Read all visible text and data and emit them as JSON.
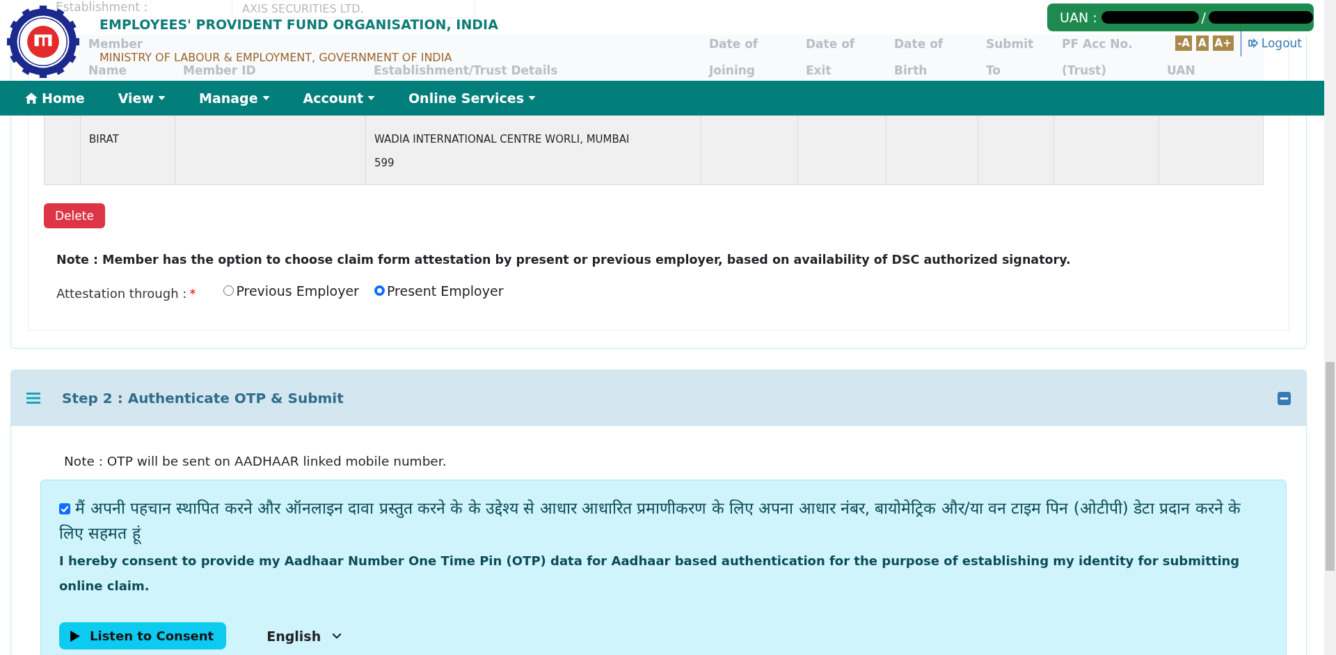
{
  "establishment": {
    "label": "Establishment :",
    "value": "AXIS SECURITIES LTD."
  },
  "header": {
    "title": "EMPLOYEES' PROVIDENT FUND ORGANISATION, INDIA",
    "subtitle": "MINISTRY OF LABOUR & EMPLOYMENT, GOVERNMENT OF INDIA",
    "uan_label": "UAN :",
    "uan_separator": "/",
    "font_sizes": [
      "-A",
      "A",
      "A+"
    ],
    "logout": "Logout"
  },
  "nav": [
    {
      "label": "Home",
      "kind": "home"
    },
    {
      "label": "View",
      "kind": "dropdown"
    },
    {
      "label": "Manage",
      "kind": "dropdown"
    },
    {
      "label": "Account",
      "kind": "dropdown"
    },
    {
      "label": "Online Services",
      "kind": "dropdown"
    }
  ],
  "table": {
    "columns": [
      {
        "lines": [
          "Member",
          "Name"
        ]
      },
      {
        "lines": [
          "Member ID"
        ]
      },
      {
        "lines": [
          "Establishment/Trust Details"
        ]
      },
      {
        "lines": [
          "Date of",
          "Joining"
        ]
      },
      {
        "lines": [
          "Date of",
          "Exit"
        ]
      },
      {
        "lines": [
          "Date of",
          "Birth"
        ]
      },
      {
        "lines": [
          "Submit",
          "To"
        ]
      },
      {
        "lines": [
          "PF Acc No.",
          "(Trust)"
        ]
      },
      {
        "lines": [
          "UAN"
        ]
      }
    ],
    "rows": [
      {
        "member_name": "BIRAT",
        "establishment": "WADIA INTERNATIONAL CENTRE WORLI, MUMBAI 599"
      }
    ]
  },
  "delete_button": "Delete",
  "note": "Note : Member has the option to choose claim form attestation by present or previous employer, based on availability of DSC authorized signatory.",
  "attestation": {
    "label": "Attestation through :",
    "required_mark": "*",
    "options": [
      {
        "label": "Previous Employer",
        "selected": false
      },
      {
        "label": "Present Employer",
        "selected": true
      }
    ]
  },
  "step2": {
    "title": "Step 2 : Authenticate OTP & Submit",
    "expanded": true,
    "note": "Note : OTP will be sent on AADHAAR linked mobile number.",
    "consent": {
      "checked": true,
      "hindi": "मैं अपनी पहचान स्थापित करने और ऑनलाइन दावा प्रस्तुत करने के के उद्देश्य से आधार आधारित प्रमाणीकरण के लिए अपना आधार नंबर, बायोमेट्रिक और/या वन टाइम पिन (ओटीपी) डेटा प्रदान करने के लिए सहमत हूं",
      "english": "I hereby consent to provide my Aadhaar Number One Time Pin (OTP) data for Aadhaar based authentication for the purpose of establishing my identity for submitting online claim.",
      "listen_button": "Listen to Consent",
      "language": "English"
    }
  }
}
